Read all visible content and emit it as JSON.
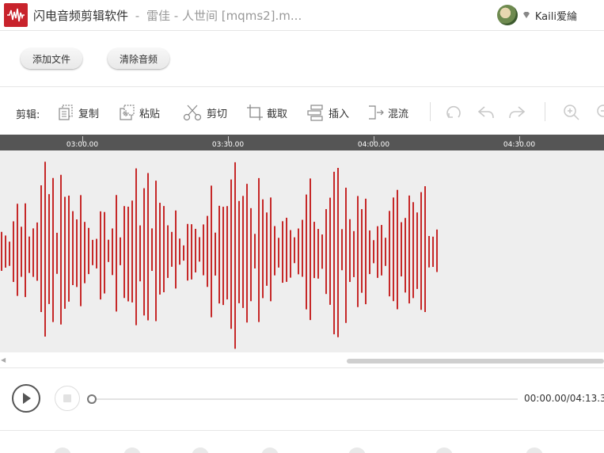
{
  "titlebar": {
    "app_name": "闪电音频剪辑软件",
    "separator": "-",
    "file_name": "雷佳 - 人世间 [mqms2].m...",
    "username": "Kaili爱綸"
  },
  "topbar": {
    "add_file": "添加文件",
    "clear_audio": "清除音频"
  },
  "toolbar": {
    "label": "剪辑:",
    "copy": "复制",
    "paste": "粘贴",
    "cut": "剪切",
    "crop": "截取",
    "insert": "插入",
    "mix": "混流"
  },
  "ruler": {
    "ticks": [
      "03:00.00",
      "03:30.00",
      "04:00.00",
      "04:30.00"
    ]
  },
  "player": {
    "time": "00:00.00/04:13.3"
  },
  "colors": {
    "accent": "#c8232c",
    "wave": "#c62828",
    "ruler": "#555555",
    "wave_bg": "#eeeeee"
  }
}
